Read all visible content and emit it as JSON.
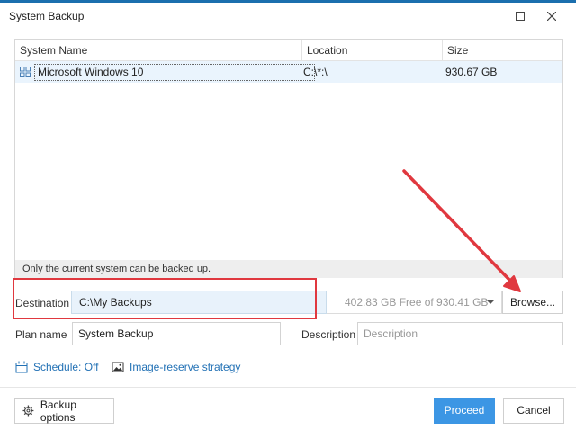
{
  "window": {
    "title": "System Backup"
  },
  "icons": {
    "maximize": "maximize-icon",
    "close": "close-icon",
    "system": "windows-logo-icon",
    "dropdown": "chevron-down-icon",
    "calendar": "calendar-icon",
    "image": "image-icon",
    "gear": "gear-icon"
  },
  "table": {
    "columns": [
      "System Name",
      "Location",
      "Size"
    ],
    "rows": [
      {
        "name": "Microsoft Windows 10",
        "location": "C:\\*:\\",
        "size": "930.67 GB"
      }
    ],
    "footer": "Only the current system can be backed up."
  },
  "destination": {
    "label": "Destination",
    "value": "C:\\My Backups",
    "free_space": "402.83 GB Free of 930.41 GB",
    "browse_label": "Browse..."
  },
  "plan": {
    "label": "Plan name",
    "value": "System Backup"
  },
  "description": {
    "label": "Description",
    "placeholder": "Description"
  },
  "links": {
    "schedule": "Schedule: Off",
    "image_reserve": "Image-reserve strategy"
  },
  "buttons": {
    "backup_options": "Backup options",
    "proceed": "Proceed",
    "cancel": "Cancel"
  },
  "colors": {
    "accent": "#3c96e4",
    "link": "#2271b5",
    "annotation": "#e0383f",
    "selected_row": "#eaf4fd"
  }
}
